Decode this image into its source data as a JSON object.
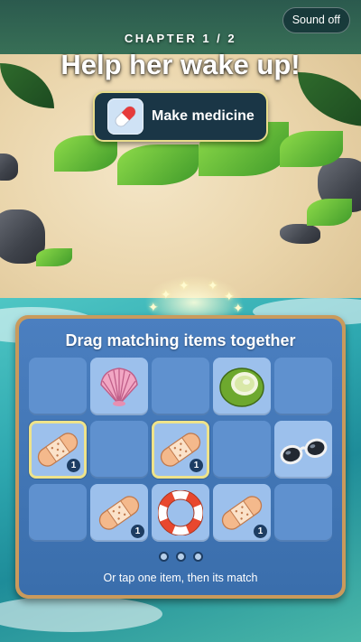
{
  "header": {
    "sound_button": "Sound off",
    "chapter": "CHAPTER 1 / 2",
    "title": "Help her wake up!"
  },
  "goal": {
    "icon": "pill-icon",
    "label": "Make medicine"
  },
  "board": {
    "instruction": "Drag matching items together",
    "hint": "Or tap one item, then its match",
    "page_dots": 3,
    "rows": [
      [
        {
          "item": null
        },
        {
          "item": "seashell-icon"
        },
        {
          "item": null
        },
        {
          "item": "coconut-icon"
        },
        {
          "item": null
        }
      ],
      [
        {
          "item": "bandage-icon",
          "level": "1",
          "selected": true
        },
        {
          "item": null
        },
        {
          "item": "bandage-icon",
          "level": "1",
          "selected": true
        },
        {
          "item": null
        },
        {
          "item": "sunglasses-icon"
        }
      ],
      [
        {
          "item": null
        },
        {
          "item": "bandage-icon",
          "level": "1"
        },
        {
          "item": "lifebuoy-icon"
        },
        {
          "item": "bandage-icon",
          "level": "1"
        },
        {
          "item": null
        }
      ]
    ]
  },
  "colors": {
    "panel_border": "#c99a5c",
    "panel_fill": "#4b7fc0",
    "selected_outline": "#eee38a",
    "badge": "#1d3d63"
  }
}
